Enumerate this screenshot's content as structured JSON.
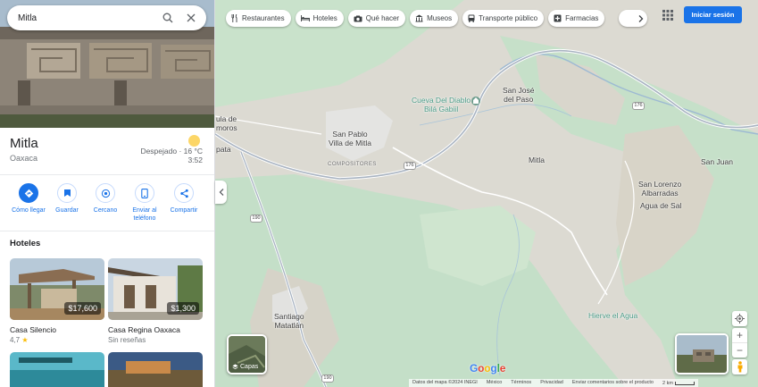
{
  "search": {
    "value": "Mitla"
  },
  "place": {
    "title": "Mitla",
    "region": "Oaxaca",
    "weather": {
      "condition_temp": "Despejado · 16 °C",
      "time": "3:52"
    }
  },
  "actions": [
    {
      "label": "Cómo llegar",
      "icon": "directions-icon"
    },
    {
      "label": "Guardar",
      "icon": "bookmark-icon"
    },
    {
      "label": "Cercano",
      "icon": "nearby-icon"
    },
    {
      "label": "Enviar al teléfono",
      "icon": "phone-icon"
    },
    {
      "label": "Compartir",
      "icon": "share-icon"
    }
  ],
  "hotels": {
    "heading": "Hoteles",
    "items": [
      {
        "name": "Casa Silencio",
        "price": "$17,600",
        "rating": "4,7",
        "sub": ""
      },
      {
        "name": "Casa Regina Oaxaca",
        "price": "$1,300",
        "rating": "",
        "sub": "Sin reseñas"
      }
    ]
  },
  "chips": [
    {
      "label": "Restaurantes",
      "icon": "fork-knife-icon"
    },
    {
      "label": "Hoteles",
      "icon": "bed-icon"
    },
    {
      "label": "Qué hacer",
      "icon": "camera-icon"
    },
    {
      "label": "Museos",
      "icon": "museum-icon"
    },
    {
      "label": "Transporte público",
      "icon": "bus-icon"
    },
    {
      "label": "Farmacias",
      "icon": "pharmacy-icon"
    }
  ],
  "header": {
    "signin": "Iniciar sesión"
  },
  "map": {
    "labels": {
      "cueva": "Cueva Del Diablo\nBilá Gabiil",
      "san_jose": "San José\ndel Paso",
      "san_pablo": "San Pablo\nVilla de Mitla",
      "compositores": "COMPOSITORES",
      "mitla": "Mitla",
      "san_juan": "San Juan",
      "san_lorenzo": "San Lorenzo\nAlbarradas",
      "agua_de_sal": "Agua de Sal",
      "hierve": "Hierve el Agua",
      "santiago": "Santiago\nMatatlán",
      "edge_top": "ula de\nmoros",
      "edge_mid": "pata"
    },
    "routes": {
      "r176a": "176",
      "r176b": "176",
      "r190a": "190",
      "r190b": "190"
    },
    "layers_label": "Capas"
  },
  "footer": {
    "data": "Datos del mapa ©2024 INEGI",
    "country": "México",
    "terms": "Términos",
    "privacy": "Privacidad",
    "feedback": "Enviar comentarios sobre el producto",
    "scale": "2 km"
  },
  "colors": {
    "accent": "#1a73e8",
    "star": "#fbbc04",
    "map_green": "#bcdcc3",
    "map_land": "#dcdad2"
  }
}
